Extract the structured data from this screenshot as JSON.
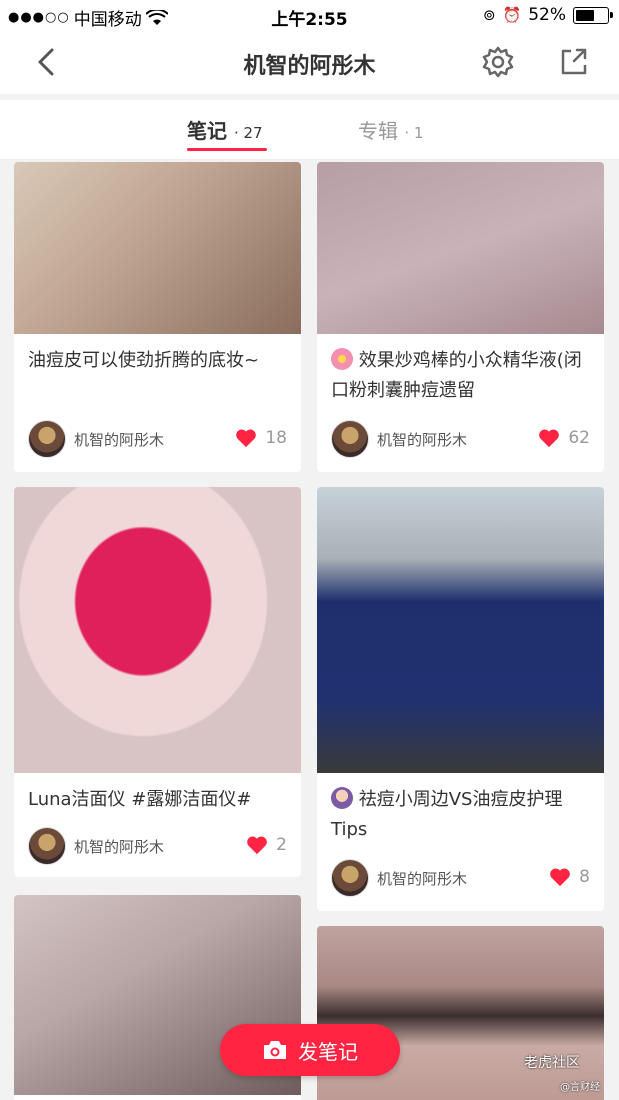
{
  "status_bar": {
    "carrier": "中国移动",
    "time": "上午2:55",
    "battery": "52%",
    "battery_level": 0.52
  },
  "nav": {
    "title": "机智的阿彤木",
    "back_icon": "chevron-left-icon",
    "settings_icon": "gear-icon",
    "share_icon": "share-icon"
  },
  "tabs": [
    {
      "label": "笔记",
      "count": "· 27",
      "active": true
    },
    {
      "label": "专辑",
      "count": "· 1",
      "active": false
    }
  ],
  "accent_color": "#ff2442",
  "cards": [
    {
      "title": "油痘皮可以使劲折腾的底妆~",
      "author": "机智的阿彤木",
      "likes": "18"
    },
    {
      "title": "效果炒鸡棒的小众精华液(闭口粉刺囊肿痘遗留",
      "author": "机智的阿彤木",
      "likes": "62"
    },
    {
      "title": "Luna洁面仪 #露娜洁面仪#",
      "author": "机智的阿彤木",
      "likes": "2"
    },
    {
      "title": "祛痘小周边VS油痘皮护理Tips",
      "author": "机智的阿彤木",
      "likes": "8"
    }
  ],
  "fab": {
    "label": "发笔记",
    "icon": "camera-icon"
  },
  "watermark": {
    "line1": "老虎社区",
    "line2": "@言财经"
  }
}
